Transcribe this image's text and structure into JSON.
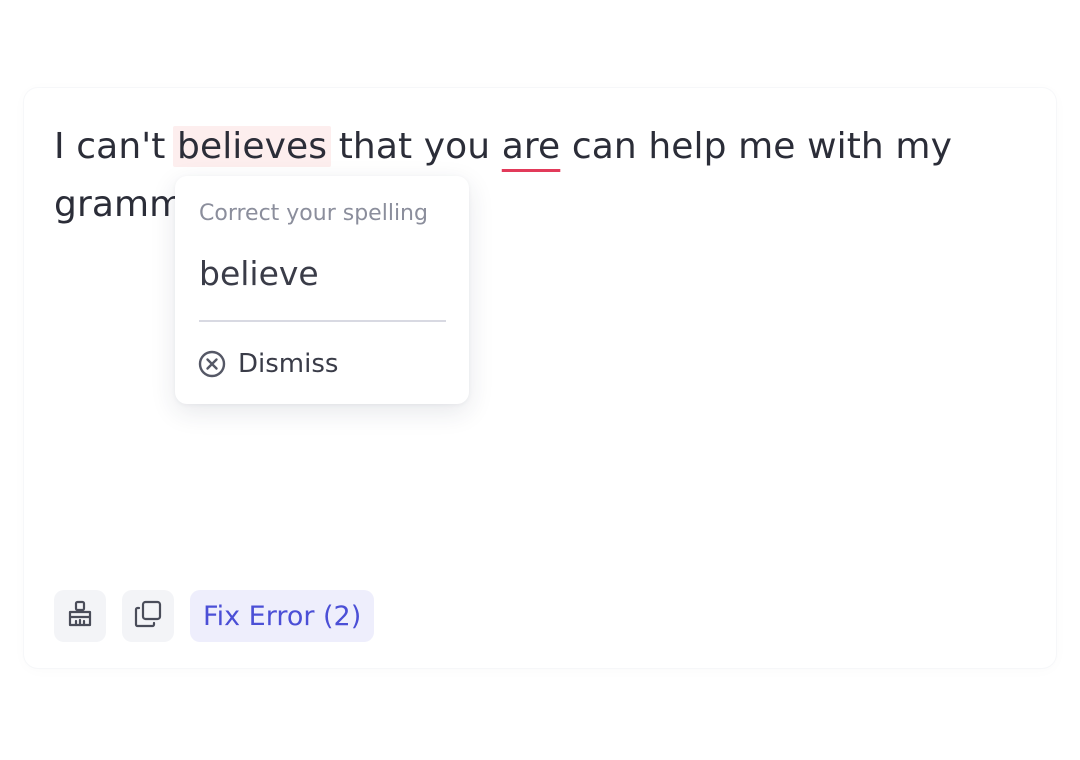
{
  "editor": {
    "text_before": "I can't ",
    "error_word_1": "believes",
    "text_middle": " that you ",
    "error_word_2": "are",
    "text_after": " can help me with my gramm"
  },
  "popover": {
    "title": "Correct your spelling",
    "suggestion": "believe",
    "dismiss_label": "Dismiss",
    "dismiss_icon": "close-circle-icon"
  },
  "toolbar": {
    "clear_icon": "broom-icon",
    "copy_icon": "copy-icon",
    "fix_label": "Fix Error (2)"
  },
  "colors": {
    "text": "#2b2d38",
    "error_underline": "#e23a5a",
    "error_highlight_bg": "#fdeeee",
    "accent": "#4b4fd6",
    "accent_bg": "#eeeefc",
    "muted": "#8b8e9c"
  }
}
